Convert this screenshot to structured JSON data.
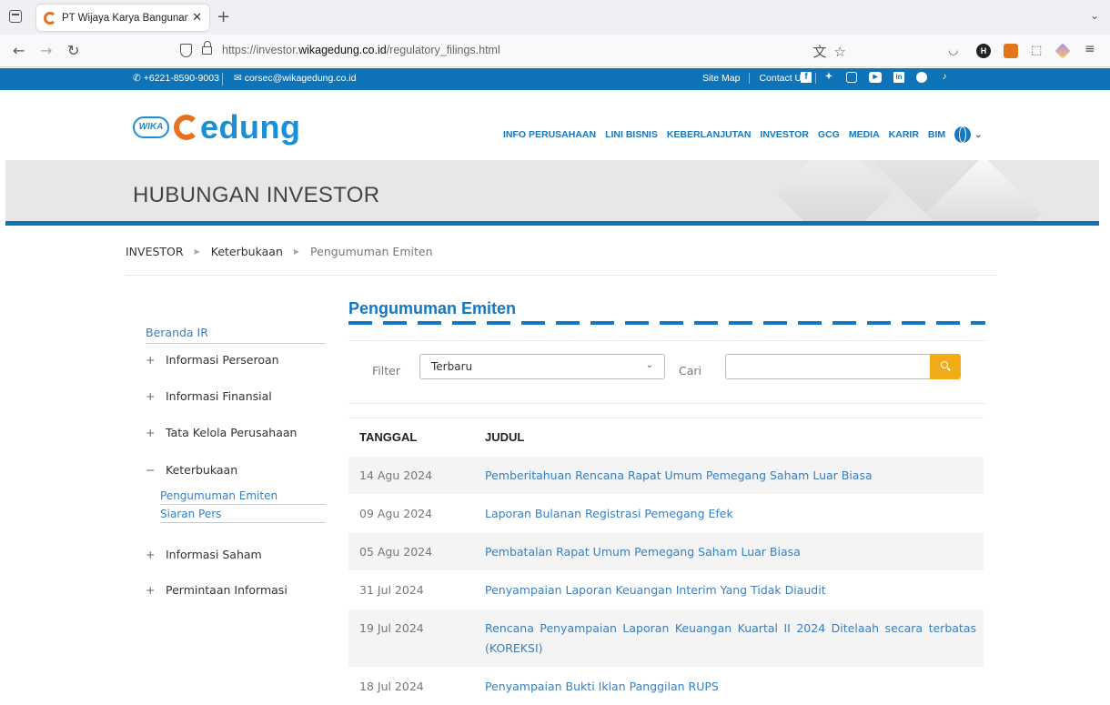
{
  "browser": {
    "tab_title": "PT Wijaya Karya Bangunan Gedung",
    "tab_close": "✕",
    "url_prefix": "https://investor.",
    "url_domain": "wikagedung.co.id",
    "url_path": "/regulatory_filings.html",
    "ext_h": "H"
  },
  "topbar": {
    "phone": "+6221-8590-9003",
    "email": "corsec@wikagedung.co.id",
    "site_map": "Site Map",
    "contact_us": "Contact Us"
  },
  "header": {
    "logo_badge": "WIKA",
    "logo_word": "edung",
    "nav": [
      "INFO PERUSAHAAN",
      "LINI BISNIS",
      "KEBERLANJUTAN",
      "INVESTOR",
      "GCG",
      "MEDIA",
      "KARIR",
      "BIM"
    ]
  },
  "banner": {
    "title": "HUBUNGAN INVESTOR"
  },
  "breadcrumb": [
    "INVESTOR",
    "Keterbukaan",
    "Pengumuman Emiten"
  ],
  "sidebar": {
    "home": "Beranda IR",
    "items": [
      {
        "sign": "+",
        "label": "Informasi Perseroan"
      },
      {
        "sign": "+",
        "label": "Informasi Finansial"
      },
      {
        "sign": "+",
        "label": "Tata Kelola Perusahaan"
      },
      {
        "sign": "−",
        "label": "Keterbukaan"
      },
      {
        "sign": "+",
        "label": "Informasi Saham"
      },
      {
        "sign": "+",
        "label": "Permintaan Informasi"
      }
    ],
    "subitems": [
      "Pengumuman Emiten",
      "Siaran Pers"
    ]
  },
  "main": {
    "heading": "Pengumuman Emiten",
    "filter_label": "Filter",
    "filter_value": "Terbaru",
    "search_label": "Cari",
    "search_value": "",
    "columns": [
      "TANGGAL",
      "JUDUL"
    ],
    "rows": [
      {
        "date": "14 Agu 2024",
        "title": "Pemberitahuan Rencana Rapat Umum Pemegang Saham Luar Biasa"
      },
      {
        "date": "09 Agu 2024",
        "title": "Laporan Bulanan Registrasi Pemegang Efek"
      },
      {
        "date": "05 Agu 2024",
        "title": "Pembatalan Rapat Umum Pemegang Saham Luar Biasa"
      },
      {
        "date": "31 Jul 2024",
        "title": "Penyampaian Laporan Keuangan Interim Yang Tidak Diaudit"
      },
      {
        "date": "19 Jul 2024",
        "title": "Rencana Penyampaian Laporan Keuangan Kuartal II 2024 Ditelaah secara terbatas (KOREKSI)"
      },
      {
        "date": "18 Jul 2024",
        "title": "Penyampaian Bukti Iklan Panggilan RUPS"
      }
    ]
  },
  "colors": {
    "brand_blue": "#0f73b7",
    "link_blue": "#3a7fc0",
    "search_orange": "#f2ab16",
    "logo_orange": "#e8711f"
  }
}
